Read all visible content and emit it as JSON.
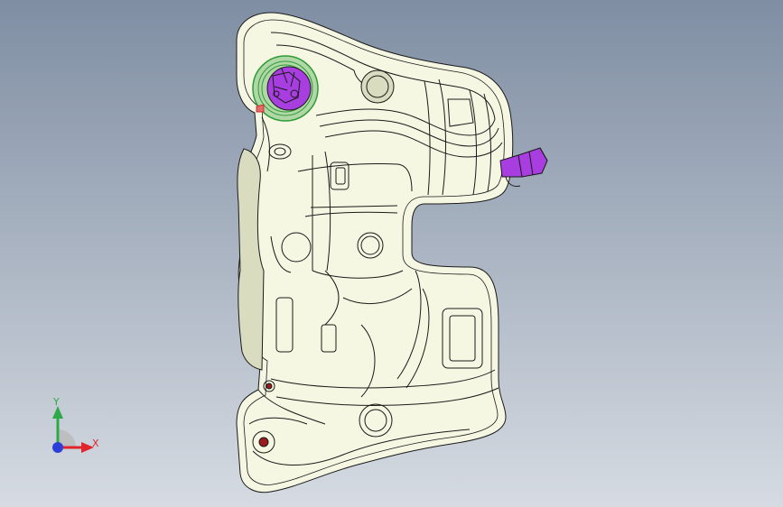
{
  "viewport": {
    "background_top": "#7f8ea3",
    "background_bottom": "#d6dbe2"
  },
  "model": {
    "name": "fuel-tank",
    "body_color": "#f6f7e2",
    "shade_color": "#dadcc0",
    "edge_color": "#1a1a1a",
    "accent_color": "#a83de0",
    "ring_color": "#2f9b37"
  },
  "triad": {
    "x_label": "X",
    "y_label": "Y",
    "x_color": "#e0262c",
    "y_color": "#2fa84a",
    "z_color": "#2b3fd6"
  }
}
